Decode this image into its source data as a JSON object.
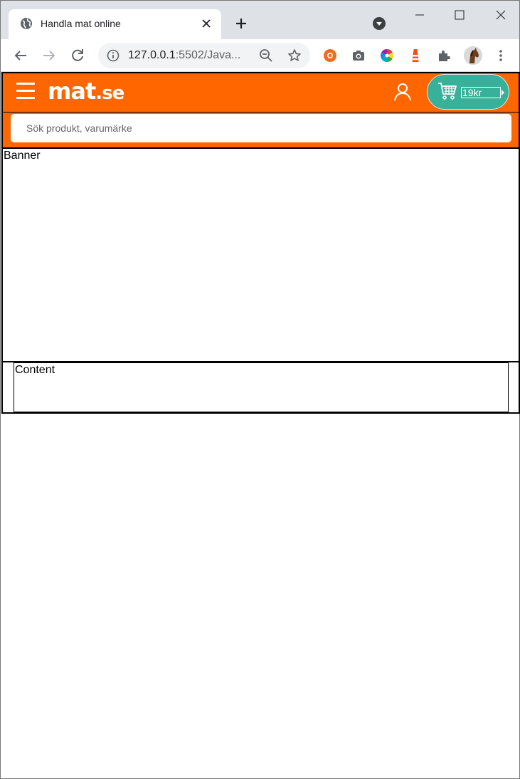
{
  "browser": {
    "tab_title": "Handla mat online",
    "url_host": "127.0.0.1",
    "url_rest": ":5502/Java..."
  },
  "site": {
    "logo_main": "mat",
    "logo_tld": ".se",
    "cart_amount": "19kr",
    "search_placeholder": "Sök produkt, varumärke",
    "brand_color": "#ff6600",
    "cart_color": "#38b19a"
  },
  "sections": {
    "banner_label": "Banner",
    "content_label": "Content"
  }
}
